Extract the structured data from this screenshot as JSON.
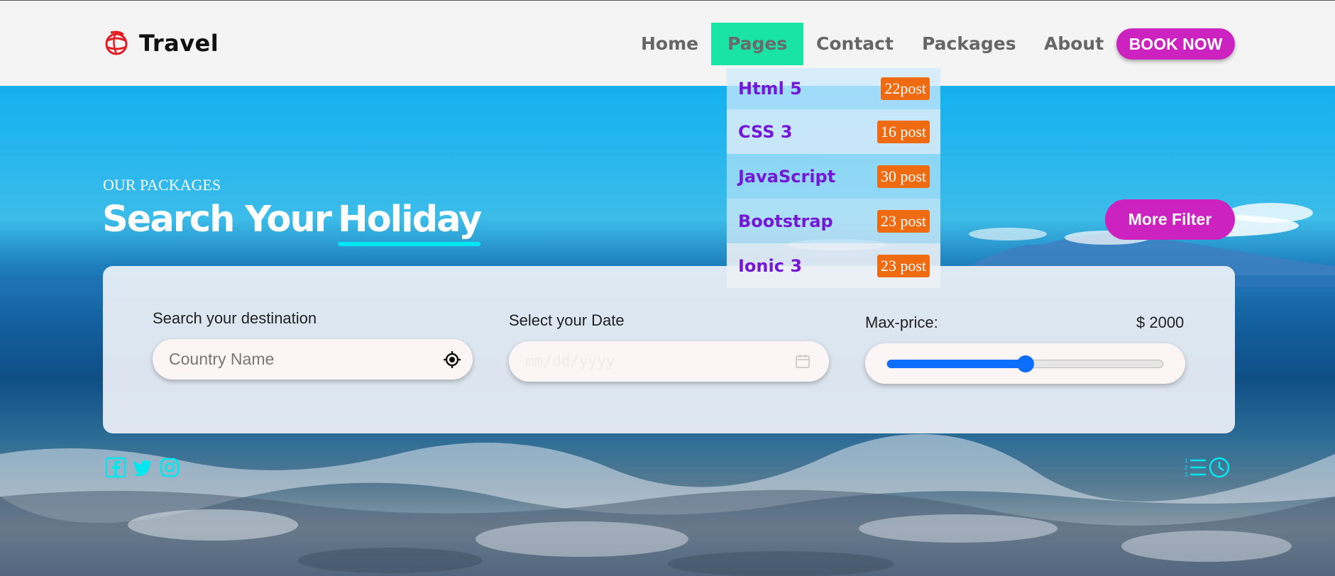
{
  "brand": {
    "name": "Travel",
    "icon": "globe-icon",
    "icon_color": "#e31b23"
  },
  "nav": {
    "items": [
      {
        "label": "Home",
        "active": false
      },
      {
        "label": "Pages",
        "active": true
      },
      {
        "label": "Contact",
        "active": false
      },
      {
        "label": "Packages",
        "active": false
      },
      {
        "label": "About",
        "active": false
      }
    ],
    "cta": "BOOK NOW",
    "active_color": "#19e3a5",
    "accent": "#cc22bf"
  },
  "dropdown": {
    "items": [
      {
        "label": "Html 5",
        "badge": "22post"
      },
      {
        "label": "CSS 3",
        "badge": "16 post"
      },
      {
        "label": "JavaScript",
        "badge": "30 post"
      },
      {
        "label": "Bootstrap",
        "badge": "23 post"
      },
      {
        "label": "Ionic 3",
        "badge": "23 post"
      }
    ],
    "label_color": "#7417d6",
    "badge_color": "#ef6b12"
  },
  "hero": {
    "kicker": "OUR PACKAGES",
    "title_part1": "Search Your",
    "title_part2": "Holiday",
    "more_filter": "More Filter"
  },
  "search": {
    "destination": {
      "label": "Search your destination",
      "placeholder": "Country Name",
      "value": "",
      "icon": "locate-icon"
    },
    "date": {
      "label": "Select your Date",
      "placeholder": "mm/dd/yyyy",
      "icon": "calendar-icon"
    },
    "price": {
      "label": "Max-price:",
      "display": "$ 2000",
      "slider_fraction": 0.5,
      "slider_color": "#0d6efd"
    }
  },
  "footer_icons": {
    "social": [
      "facebook-icon",
      "twitter-icon",
      "instagram-icon"
    ],
    "views": [
      "list-icon",
      "clock-icon"
    ],
    "color": "#00e7ef"
  }
}
